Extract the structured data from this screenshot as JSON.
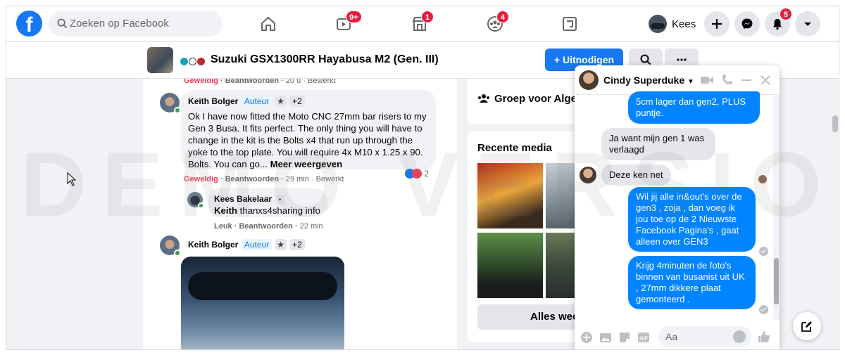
{
  "nav": {
    "logo": "f",
    "search_placeholder": "Zoeken op Facebook",
    "badges": {
      "watch": "9+",
      "marketplace": "1",
      "groups": "4",
      "notifications": "5"
    },
    "profile_name": "Kees"
  },
  "group": {
    "title": "Suzuki GSX1300RR Hayabusa M2 (Gen. III)",
    "invite_label": "+ Uitnodigen",
    "more_label": "···",
    "dot_colors": [
      "#1aa3b6",
      "#ffffff",
      "#c0282c"
    ]
  },
  "feed": {
    "prev_actions": {
      "like": "Geweldig",
      "reply": "Beantwoorden",
      "meta": "20 u · Bewerkt"
    },
    "comment1": {
      "author": "Keith Bolger",
      "role": "Auteur",
      "extra": "+2",
      "text": "Ok I have now fitted the Moto CNC 27mm bar risers to my Gen 3 Busa. It fits perfect. The only thing you will have to change in the kit is the Bolts x4 that run up through the yoke to the top plate. You will require 4x M10 x 1.25 x 90. Bolts. You can go...",
      "more": "Meer weergeven",
      "like": "Geweldig",
      "reply": "Beantwoorden",
      "meta": "29 min · Bewerkt",
      "reaction_count": "2"
    },
    "reply1": {
      "author": "Kees Bakelaar",
      "tag": "Keith",
      "text": "thanxs4sharing info",
      "like": "Leuk",
      "reply": "Beantwoorden",
      "meta": "22 min"
    },
    "comment2": {
      "author": "Keith Bolger",
      "role": "Auteur",
      "extra": "+2"
    }
  },
  "right": {
    "group_card": "Groep voor Algemeen",
    "media_title": "Recente media",
    "all_label": "Alles weergeven"
  },
  "chat": {
    "name": "Cindy Superduke",
    "input_placeholder": "Aa",
    "messages": [
      {
        "dir": "out",
        "text": "5cm lager dan gen2,  PLUS puntje."
      },
      {
        "dir": "in",
        "text": "Ja want mijn gen 1 was verlaagd"
      },
      {
        "dir": "in",
        "text": "Deze ken net"
      },
      {
        "dir": "out",
        "text": "Wil jij alle in&out's over de gen3 , zoja , dan voeg ik jou toe op de 2  Nieuwste Facebook Pagina's , gaat alleen over GEN3"
      },
      {
        "dir": "out",
        "text": "Krijg 4minuten de foto's binnen van busanist uit UK , 27mm dikkere plaat gemonteerd ."
      }
    ]
  },
  "colors": {
    "brand": "#1877f2",
    "messenger": "#0084ff",
    "badge": "#e41e3f",
    "love": "#f33e58"
  },
  "watermark": "DEMO VERSION"
}
